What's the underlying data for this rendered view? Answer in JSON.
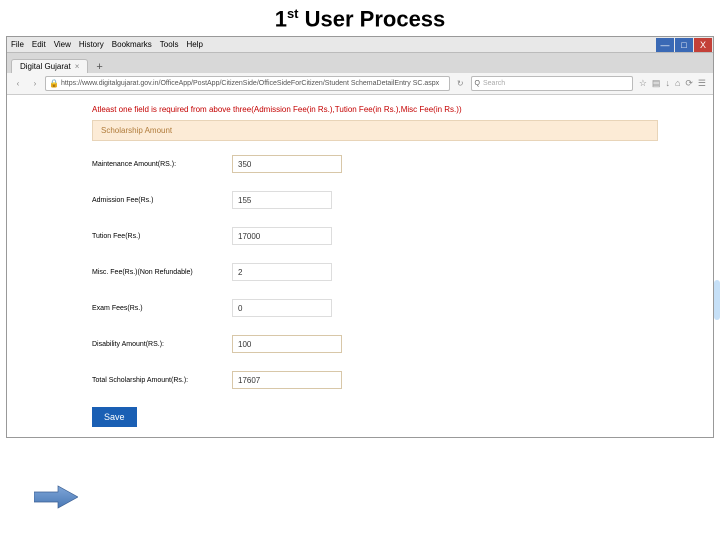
{
  "slide": {
    "title_prefix": "1",
    "title_super": "st",
    "title_suffix": " User Process"
  },
  "menu": {
    "file": "File",
    "edit": "Edit",
    "view": "View",
    "history": "History",
    "bookmarks": "Bookmarks",
    "tools": "Tools",
    "help": "Help"
  },
  "tab": {
    "title": "Digital Gujarat",
    "close": "×",
    "add": "+"
  },
  "nav": {
    "back": "‹",
    "forward": "›",
    "reload": "↻"
  },
  "url": {
    "lock": "🔒",
    "text": "https://www.digitalgujarat.gov.in/OfficeApp/PostApp/CitizenSide/OfficeSideForCitizen/Student SchemaDetailEntry SC.aspx"
  },
  "search": {
    "icon": "Q",
    "placeholder": "Search"
  },
  "toolbar": {
    "star": "☆",
    "list": "▤",
    "down": "↓",
    "home": "⌂",
    "sync": "⟳",
    "menu": "☰"
  },
  "window": {
    "min": "—",
    "max": "□",
    "close": "X"
  },
  "alert": {
    "text": "Atleast one field is required from above three(Admission Fee(in Rs.),Tution Fee(in Rs.),Misc Fee(in Rs.))"
  },
  "section": {
    "title": "Scholarship Amount"
  },
  "fields": {
    "maintenance": {
      "label": "Maintenance Amount(RS.):",
      "value": "350"
    },
    "admission": {
      "label": "Admission Fee(Rs.)",
      "value": "155"
    },
    "tution": {
      "label": "Tution Fee(Rs.)",
      "value": "17000"
    },
    "misc": {
      "label": "Misc. Fee(Rs.)(Non Refundable)",
      "value": "2"
    },
    "exam": {
      "label": "Exam Fees(Rs.)",
      "value": "0"
    },
    "disability": {
      "label": "Disability Amount(RS.):",
      "value": "100"
    },
    "total": {
      "label": "Total Scholarship Amount(Rs.):",
      "value": "17607"
    }
  },
  "buttons": {
    "save": "Save"
  }
}
